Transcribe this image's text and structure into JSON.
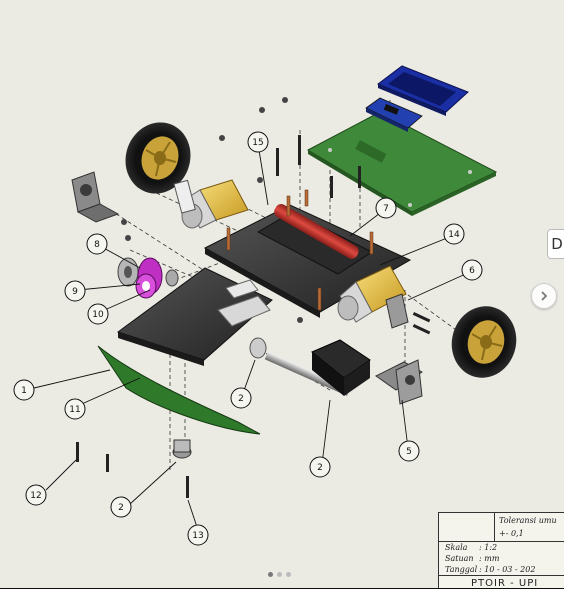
{
  "diagram": {
    "callouts": [
      {
        "number": "1"
      },
      {
        "number": "2"
      },
      {
        "number": "2"
      },
      {
        "number": "2"
      },
      {
        "number": "5"
      },
      {
        "number": "6"
      },
      {
        "number": "7"
      },
      {
        "number": "8"
      },
      {
        "number": "9"
      },
      {
        "number": "10"
      },
      {
        "number": "11"
      },
      {
        "number": "12"
      },
      {
        "number": "13"
      },
      {
        "number": "14"
      },
      {
        "number": "15"
      }
    ]
  },
  "title_block": {
    "tolerance_label": "Toleransi umu",
    "tolerance_value": "+- 0,1",
    "scale_key": "Skala",
    "scale_value": ": 1:2",
    "unit_key": "Satuan",
    "unit_value": ": mm",
    "date_key": "Tanggal",
    "date_value": ": 10 - 03 - 202",
    "company": "PTOIR - UPI"
  },
  "viewer": {
    "side_tab_label": "D",
    "pager_count": 3,
    "pager_active": 0
  },
  "colors": {
    "background": "#ecebe3",
    "pcb_green": "#3f8a3a",
    "motor_yellow": "#e6c24a",
    "battery_red": "#c4302b",
    "gear_magenta": "#c02fc4",
    "bumper_green": "#2f7a2a",
    "chassis_dark": "#3a3a3a"
  }
}
